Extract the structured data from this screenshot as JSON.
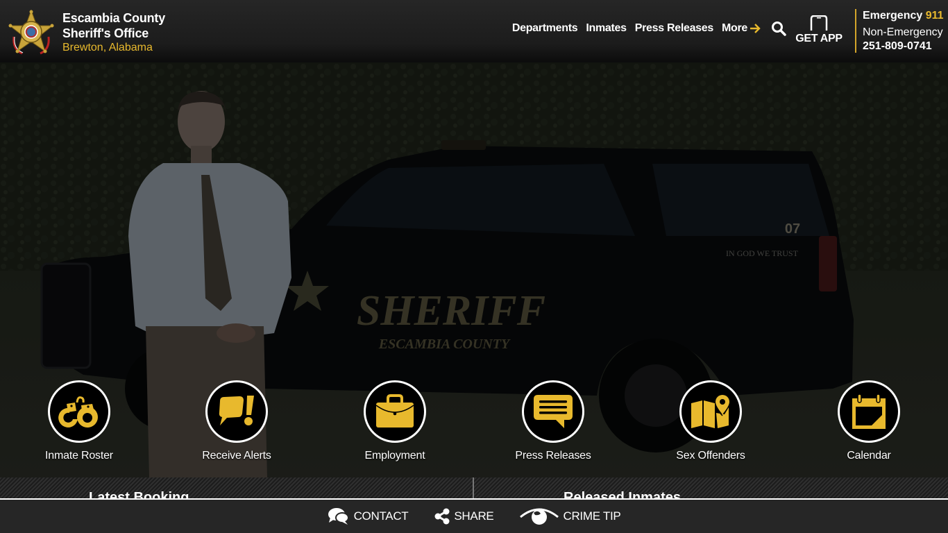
{
  "header": {
    "org_line1": "Escambia County",
    "org_line2": "Sheriff's Office",
    "location": "Brewton, Alabama",
    "logo_icon": "sheriff-star-badge",
    "nav": [
      {
        "label": "Departments"
      },
      {
        "label": "Inmates"
      },
      {
        "label": "Press Releases"
      },
      {
        "label": "More"
      }
    ],
    "more_icon": "arrow-right",
    "search_icon": "search",
    "get_app_label": "GET APP",
    "get_app_icon": "smartphone",
    "emergency_label": "Emergency",
    "emergency_number": "911",
    "non_emergency_label": "Non-Emergency",
    "non_emergency_number": "251-809-0741"
  },
  "hero": {
    "image_alt": "Sheriff standing beside Escambia County Sheriff patrol vehicle",
    "vehicle_text": "SHERIFF",
    "vehicle_subtext": "ESCAMBIA COUNTY",
    "vehicle_number": "07",
    "vehicle_motto": "IN GOD WE TRUST"
  },
  "quick_links": [
    {
      "label": "Inmate Roster",
      "icon": "handcuffs"
    },
    {
      "label": "Receive Alerts",
      "icon": "speech-alert"
    },
    {
      "label": "Employment",
      "icon": "briefcase"
    },
    {
      "label": "Press Releases",
      "icon": "message-lines"
    },
    {
      "label": "Sex Offenders",
      "icon": "map-pin"
    },
    {
      "label": "Calendar",
      "icon": "calendar"
    }
  ],
  "sections": {
    "left_heading": "Latest Booking",
    "right_heading": "Released Inmates"
  },
  "footer": {
    "contact_label": "CONTACT",
    "share_label": "SHARE",
    "crime_tip_label": "CRIME TIP"
  },
  "colors": {
    "accent_gold": "#e8b92d",
    "header_bg": "#1f1f1f",
    "footer_bg": "#262626"
  }
}
